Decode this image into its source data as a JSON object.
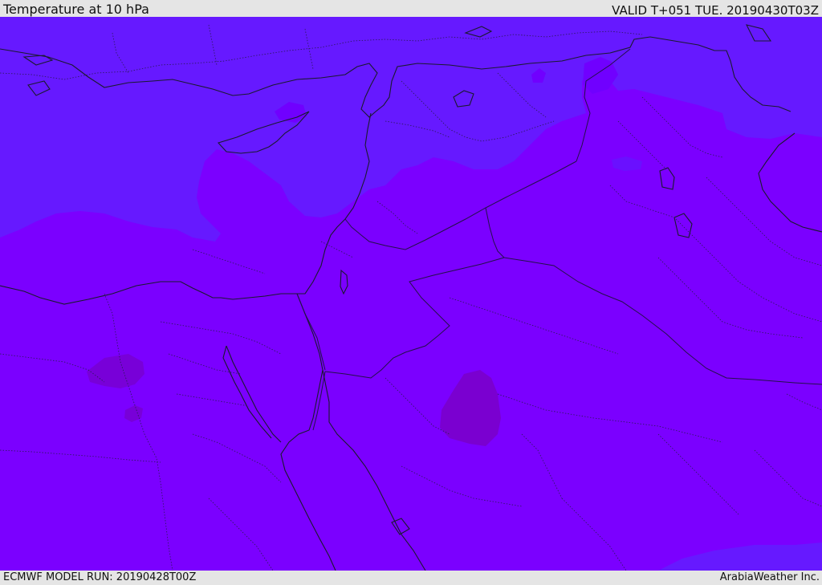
{
  "header": {
    "title": "Temperature at 10 hPa",
    "valid": "VALID T+051 TUE. 20190430T03Z"
  },
  "footer": {
    "model_run": "ECMWF MODEL RUN: 20190428T00Z",
    "credit": "ArabiaWeather Inc."
  },
  "map": {
    "colors": {
      "warm_zone": "#7b00ff",
      "cool_zone": "#6619ff",
      "hot_spot": "#7a00dd",
      "coastline": "#1a1a2e",
      "borders": "#2a1a55"
    }
  }
}
